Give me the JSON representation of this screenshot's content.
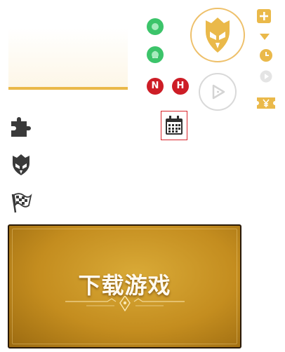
{
  "status": {
    "presence_1": "online",
    "presence_2": "locked"
  },
  "badges": {
    "n_badge": "N",
    "h_badge": "H"
  },
  "banner": {
    "title": "下载游戏"
  },
  "icons": {
    "hero_avatar": "helmet-icon",
    "play": "play-icon",
    "calendar": "calendar-icon",
    "puzzle": "puzzle-icon",
    "helmet_small": "helmet-icon",
    "flag": "checkered-flag-icon",
    "plus": "plus-icon",
    "dropdown": "triangle-down-icon",
    "clock": "clock-icon",
    "small_play": "play-circle-icon",
    "ticket": "ticket-icon"
  },
  "colors": {
    "accent_gold": "#eab94a",
    "online_green": "#3cc46a",
    "badge_red": "#cd1d26",
    "highlight_red": "#d9252c"
  }
}
